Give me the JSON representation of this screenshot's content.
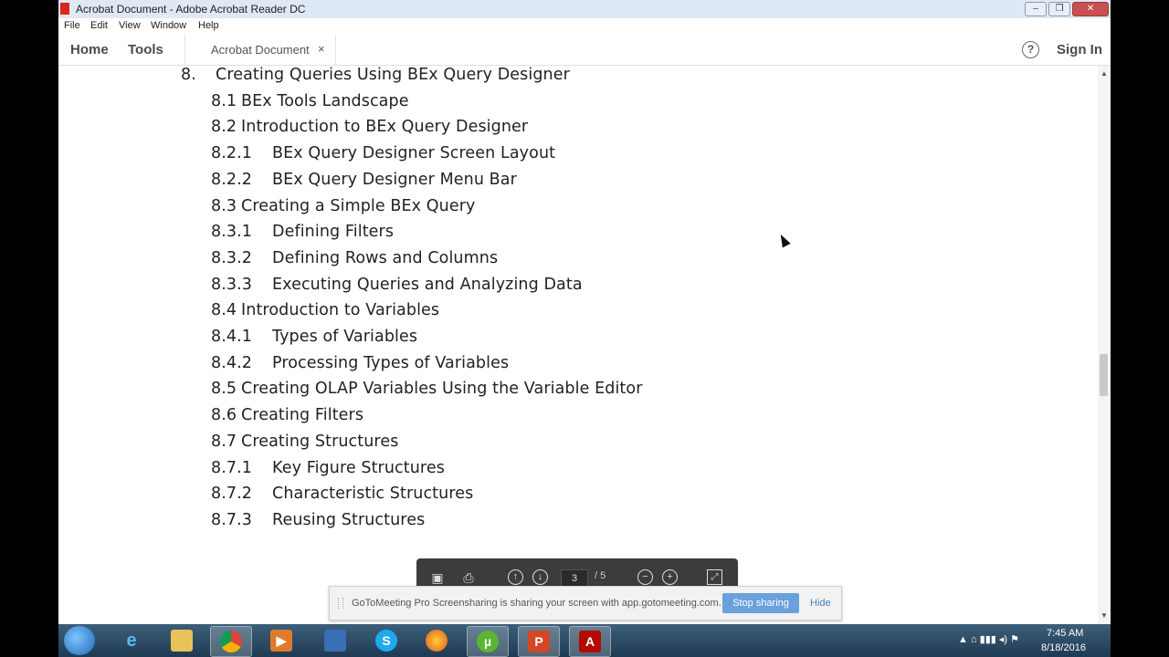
{
  "window": {
    "title": "Acrobat Document - Adobe Acrobat Reader DC"
  },
  "menu": [
    "File",
    "Edit",
    "View",
    "Window",
    "Help"
  ],
  "tabs": {
    "home": "Home",
    "tools": "Tools",
    "document": "Acrobat Document",
    "close_glyph": "×",
    "help_glyph": "?",
    "sign_in": "Sign In"
  },
  "toc": [
    {
      "num": "8.",
      "text": "Creating Queries Using BEx Query Designer"
    },
    {
      "num": "8.1",
      "text": "BEx Tools Landscape"
    },
    {
      "num": "8.2",
      "text": "Introduction to BEx Query Designer"
    },
    {
      "num": "8.2.1",
      "text": "BEx Query Designer Screen Layout"
    },
    {
      "num": "8.2.2",
      "text": "BEx Query Designer Menu Bar"
    },
    {
      "num": "8.3",
      "text": "Creating a Simple BEx Query"
    },
    {
      "num": "8.3.1",
      "text": "Defining Filters"
    },
    {
      "num": "8.3.2",
      "text": "Defining Rows and Columns"
    },
    {
      "num": "8.3.3",
      "text": "Executing Queries and Analyzing Data"
    },
    {
      "num": "8.4",
      "text": "Introduction to Variables"
    },
    {
      "num": "8.4.1",
      "text": "Types of Variables"
    },
    {
      "num": "8.4.2",
      "text": "Processing Types of Variables"
    },
    {
      "num": "8.5",
      "text": "Creating OLAP Variables Using the Variable Editor"
    },
    {
      "num": "8.6",
      "text": "Creating Filters"
    },
    {
      "num": "8.7",
      "text": "Creating Structures"
    },
    {
      "num": "8.7.1",
      "text": "Key Figure Structures"
    },
    {
      "num": "8.7.2",
      "text": "Characteristic Structures"
    },
    {
      "num": "8.7.3",
      "text": "Reusing Structures"
    }
  ],
  "floating_toolbar": {
    "page_current": "3",
    "page_total": "/ 5"
  },
  "screenshare": {
    "message": "GoToMeeting Pro Screensharing is sharing your screen with app.gotomeeting.com.",
    "stop_label": "Stop sharing",
    "hide_label": "Hide"
  },
  "taskbar": {
    "apps": [
      "windows-start",
      "internet-explorer",
      "file-explorer",
      "chrome",
      "media-player",
      "network-tool",
      "skype",
      "firefox",
      "utorrent",
      "powerpoint",
      "acrobat-reader"
    ],
    "time": "7:45 AM",
    "date": "8/18/2016"
  }
}
